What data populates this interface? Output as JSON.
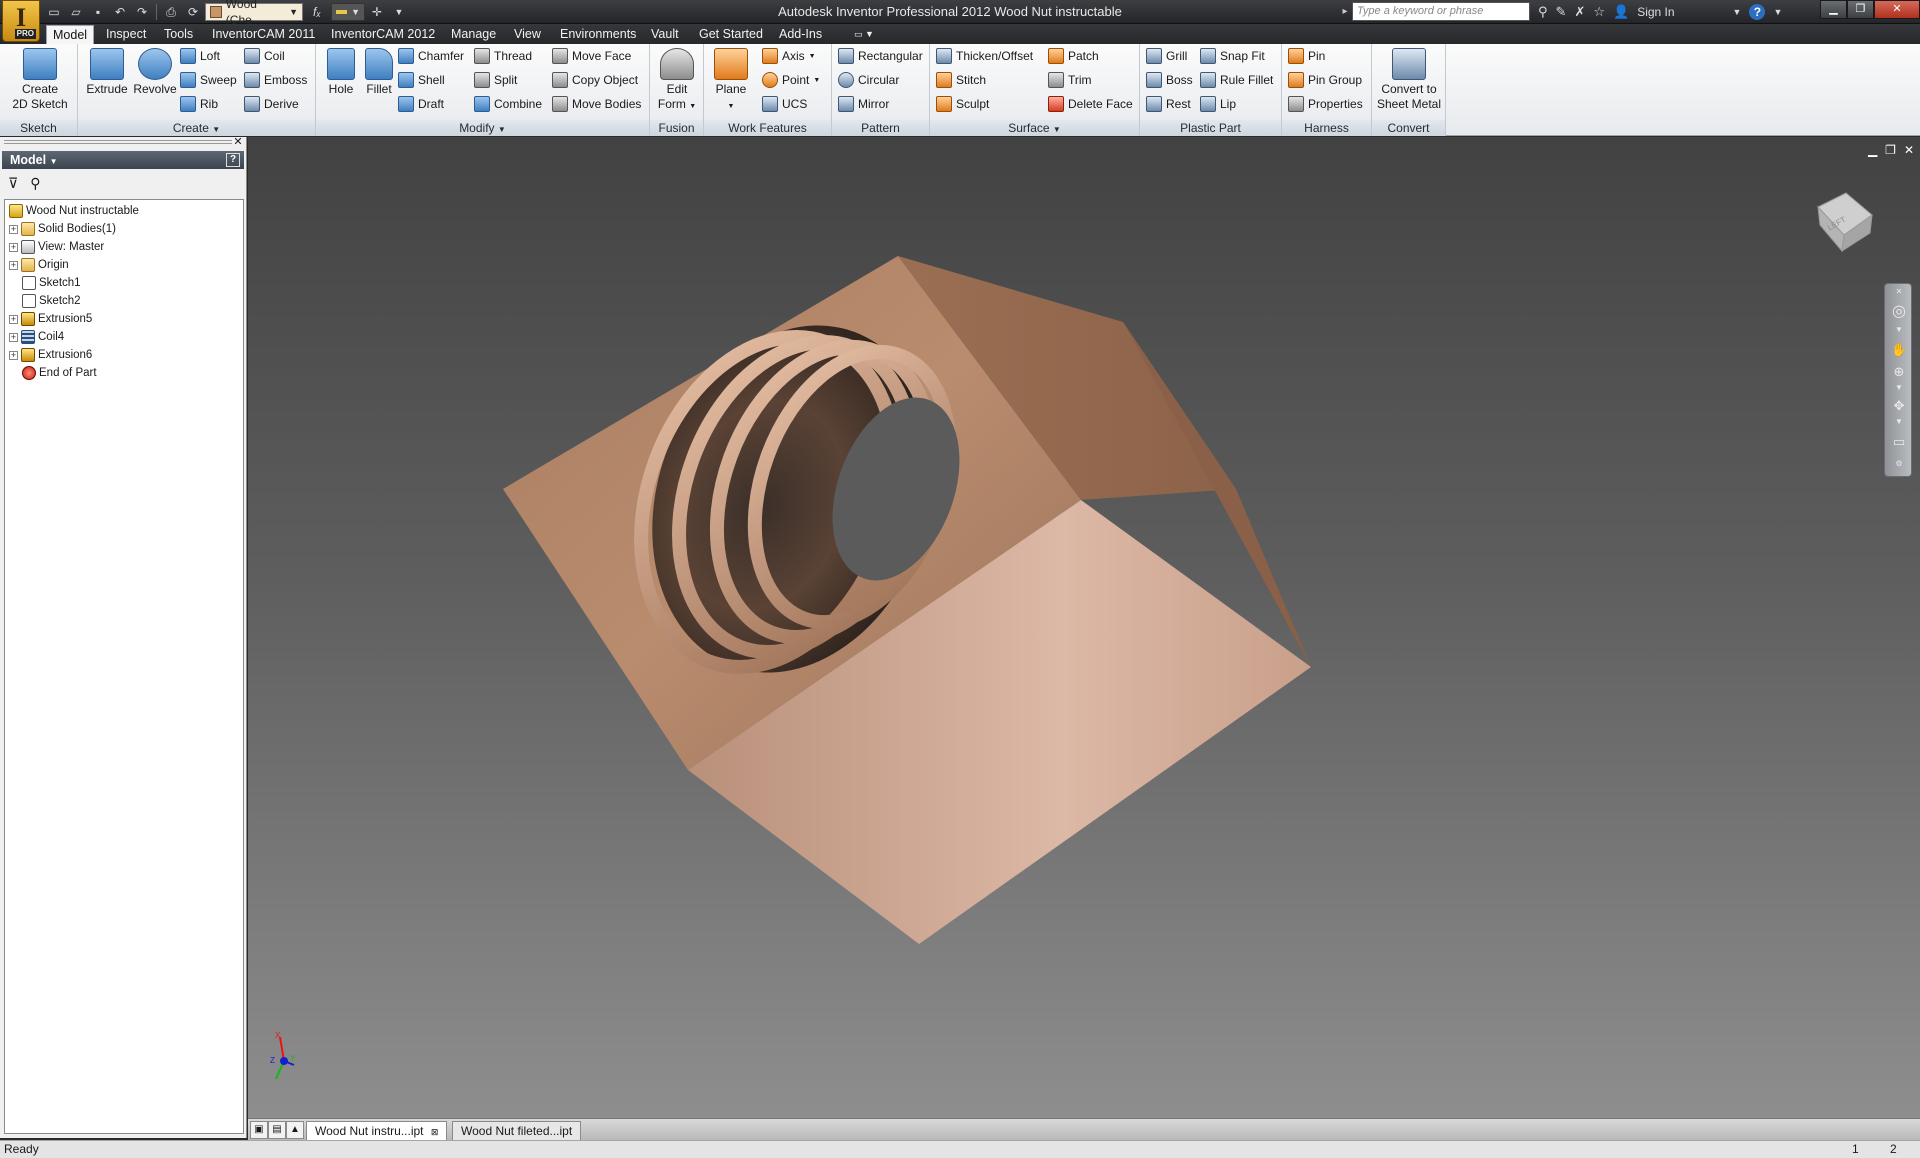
{
  "app_button": {
    "letter": "I",
    "badge": "PRO"
  },
  "qat": {
    "material": "Wood (Che",
    "fx": "fₓ"
  },
  "title": "Autodesk Inventor Professional 2012    Wood Nut instructable",
  "search": {
    "placeholder": "Type a keyword or phrase"
  },
  "title_tools": {
    "sign_in": "Sign In",
    "help": "?"
  },
  "tabs": [
    {
      "label": "Model",
      "active": true
    },
    {
      "label": "Inspect"
    },
    {
      "label": "Tools"
    },
    {
      "label": "InventorCAM 2011"
    },
    {
      "label": "InventorCAM 2012"
    },
    {
      "label": "Manage"
    },
    {
      "label": "View"
    },
    {
      "label": "Environments"
    },
    {
      "label": "Vault"
    },
    {
      "label": "Get Started"
    },
    {
      "label": "Add-Ins"
    }
  ],
  "ribbon": {
    "sketch": {
      "title": "Sketch",
      "create_2d_sketch_l1": "Create",
      "create_2d_sketch_l2": "2D Sketch"
    },
    "create": {
      "title": "Create",
      "extrude": "Extrude",
      "revolve": "Revolve",
      "loft": "Loft",
      "sweep": "Sweep",
      "rib": "Rib",
      "coil": "Coil",
      "emboss": "Emboss",
      "derive": "Derive"
    },
    "modify": {
      "title": "Modify",
      "hole": "Hole",
      "fillet": "Fillet",
      "chamfer": "Chamfer",
      "shell": "Shell",
      "draft": "Draft",
      "thread": "Thread",
      "split": "Split",
      "combine": "Combine",
      "move_face": "Move Face",
      "copy_object": "Copy Object",
      "move_bodies": "Move Bodies"
    },
    "fusion": {
      "title": "Fusion",
      "edit_form_l1": "Edit",
      "edit_form_l2": "Form"
    },
    "work_features": {
      "title": "Work Features",
      "plane": "Plane",
      "axis": "Axis",
      "point": "Point",
      "ucs": "UCS"
    },
    "pattern": {
      "title": "Pattern",
      "rectangular": "Rectangular",
      "circular": "Circular",
      "mirror": "Mirror"
    },
    "surface": {
      "title": "Surface",
      "thicken_offset": "Thicken/Offset",
      "stitch": "Stitch",
      "sculpt": "Sculpt",
      "patch": "Patch",
      "trim": "Trim",
      "delete_face": "Delete Face"
    },
    "plastic_part": {
      "title": "Plastic Part",
      "grill": "Grill",
      "boss": "Boss",
      "rest": "Rest",
      "snap_fit": "Snap Fit",
      "rule_fillet": "Rule Fillet",
      "lip": "Lip"
    },
    "harness": {
      "title": "Harness",
      "pin": "Pin",
      "pin_group": "Pin Group",
      "properties": "Properties"
    },
    "convert": {
      "title": "Convert",
      "convert_l1": "Convert to",
      "convert_l2": "Sheet Metal"
    }
  },
  "browser": {
    "title": "Model",
    "help": "?",
    "tree": [
      {
        "label": "Wood Nut instructable",
        "icon": "part-icon",
        "expander": false
      },
      {
        "label": "Solid Bodies(1)",
        "icon": "folder-icon",
        "expander": true
      },
      {
        "label": "View: Master",
        "icon": "view-icon",
        "expander": true
      },
      {
        "label": "Origin",
        "icon": "folder-icon",
        "expander": true
      },
      {
        "label": "Sketch1",
        "icon": "sketch-icon",
        "expander": false
      },
      {
        "label": "Sketch2",
        "icon": "sketch-icon",
        "expander": false
      },
      {
        "label": "Extrusion5",
        "icon": "extrusion-icon",
        "expander": true
      },
      {
        "label": "Coil4",
        "icon": "coil-icon",
        "expander": true
      },
      {
        "label": "Extrusion6",
        "icon": "extrusion-icon",
        "expander": true
      },
      {
        "label": "End of Part",
        "icon": "end-of-part-icon",
        "expander": false
      }
    ]
  },
  "viewcube": {
    "face_label": "LEFT"
  },
  "triad": {
    "x": "X",
    "y": "Y",
    "z": "Z"
  },
  "doc_tabs": [
    {
      "label": "Wood Nut instru...ipt",
      "active": true
    },
    {
      "label": "Wood Nut fileted...ipt",
      "active": false
    }
  ],
  "status": {
    "text": "Ready",
    "n1": "1",
    "n2": "2"
  },
  "colors": {
    "wood_light": "#d9ae94",
    "wood_mid": "#b98a6c",
    "wood_dark": "#7d5a44"
  }
}
